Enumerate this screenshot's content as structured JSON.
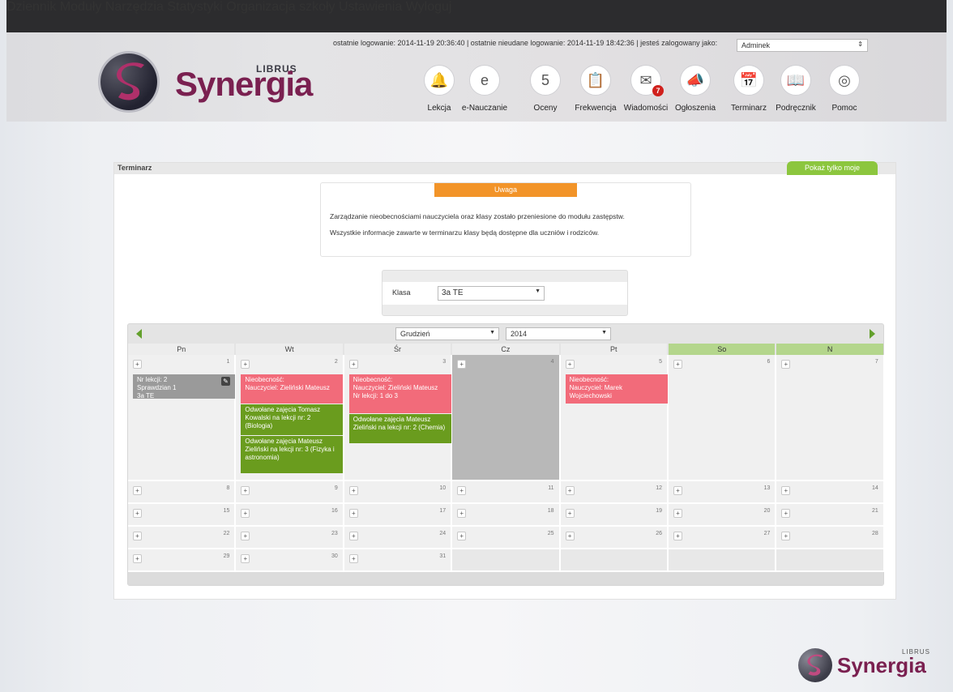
{
  "topnav": [
    "Dziennik",
    "Moduły",
    "Narzędzia",
    "Statystyki",
    "Organizacja szkoły",
    "Ustawienia",
    "Wyloguj"
  ],
  "loginbar": "ostatnie logowanie: 2014-11-19 20:36:40  |  ostatnie nieudane logowanie: 2014-11-19 18:42:36  |  jesteś zalogowany jako:",
  "user": "Adminek",
  "logo": {
    "librus": "LIBRUS",
    "name": "Synergia"
  },
  "modules": [
    {
      "label": "Lekcja",
      "icon": "bell-icon"
    },
    {
      "label": "e-Nauczanie",
      "icon": "e-letter-icon"
    },
    {
      "label": "Oceny",
      "icon": "grades-icon"
    },
    {
      "label": "Frekwencja",
      "icon": "clipboard-icon"
    },
    {
      "label": "Wiadomości",
      "icon": "envelope-icon",
      "badge": "7"
    },
    {
      "label": "Ogłoszenia",
      "icon": "megaphone-icon"
    },
    {
      "label": "Terminarz",
      "icon": "calendar-clock-icon"
    },
    {
      "label": "Podręcznik",
      "icon": "book-icon"
    },
    {
      "label": "Pomoc",
      "icon": "lifebuoy-icon"
    }
  ],
  "panel": {
    "title": "Terminarz",
    "show_mine": "Pokaż tylko moje"
  },
  "notice": {
    "title": "Uwaga",
    "line1": "Zarządzanie nieobecnościami nauczyciela oraz klasy zostało przeniesione do modułu zastępstw.",
    "line2": "Wszystkie informacje zawarte w terminarzu klasy będą dostępne dla uczniów i rodziców."
  },
  "klasa": {
    "label": "Klasa",
    "value": "3a TE"
  },
  "calendar": {
    "month": "Grudzień",
    "year": "2014",
    "days": [
      "Pn",
      "Wt",
      "Śr",
      "Cz",
      "Pt",
      "So",
      "N"
    ],
    "weeks": [
      [
        "1",
        "2",
        "3",
        "4",
        "5",
        "6",
        "7"
      ],
      [
        "8",
        "9",
        "10",
        "11",
        "12",
        "13",
        "14"
      ],
      [
        "15",
        "16",
        "17",
        "18",
        "19",
        "20",
        "21"
      ],
      [
        "22",
        "23",
        "24",
        "25",
        "26",
        "27",
        "28"
      ],
      [
        "29",
        "30",
        "31",
        "",
        "",
        "",
        ""
      ]
    ],
    "events": {
      "mon1": {
        "lines": [
          "Nr lekcji: 2",
          "Sprawdzian 1",
          "3a TE"
        ]
      },
      "tue1": "Nieobecność:\nNauczyciel: Zieliński Mateusz",
      "tue2": "Odwołane zajęcia Tomasz Kowalski na lekcji nr: 2 (Biologia)",
      "tue3": "Odwołane zajęcia Mateusz Zieliński na lekcji nr: 3 (Fizyka i astronomia)",
      "wed1": "Nieobecność:\nNauczyciel: Zieliński Mateusz\nNr lekcji: 1 do 3",
      "wed2": "Odwołane zajęcia Mateusz Zieliński na lekcji nr: 2 (Chemia)",
      "fri1": "Nieobecność:\nNauczyciel: Marek Wojciechowski"
    }
  },
  "bottom_logo": {
    "librus": "LIBRUS",
    "name": "Synergia"
  },
  "colors": {
    "accent": "#7a2050",
    "green": "#8cc63e",
    "orange": "#f29429",
    "red": "#f26b7a"
  }
}
